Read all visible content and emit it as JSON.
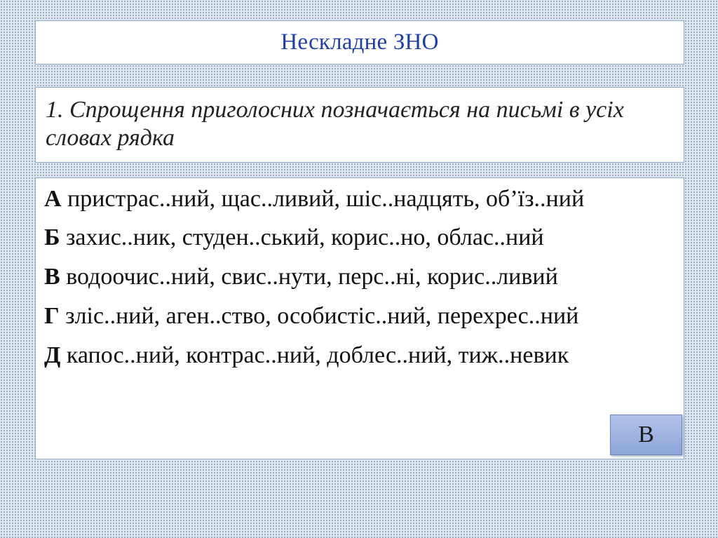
{
  "title": "Нескладне ЗНО",
  "question": "1. Спрощення приголосних позначається на письмі в усіх словах рядка",
  "options": [
    {
      "letter": "А",
      "text": " пристрас..ний, щас..ливий, шіс..надцять, об’їз..ний"
    },
    {
      "letter": "Б",
      "text": " захис..ник, студен..ський, корис..но, облас..ний"
    },
    {
      "letter": "В",
      "text": " водоочис..ний, свис..нути, перс..ні, корис..ливий"
    },
    {
      "letter": "Г",
      "text": " зліс..ний, аген..ство, особистіс..ний, перехрес..ний"
    },
    {
      "letter": "Д",
      "text": " капос..ний, контрас..ний, доблес..ний, тиж..невик"
    }
  ],
  "answer": "В"
}
